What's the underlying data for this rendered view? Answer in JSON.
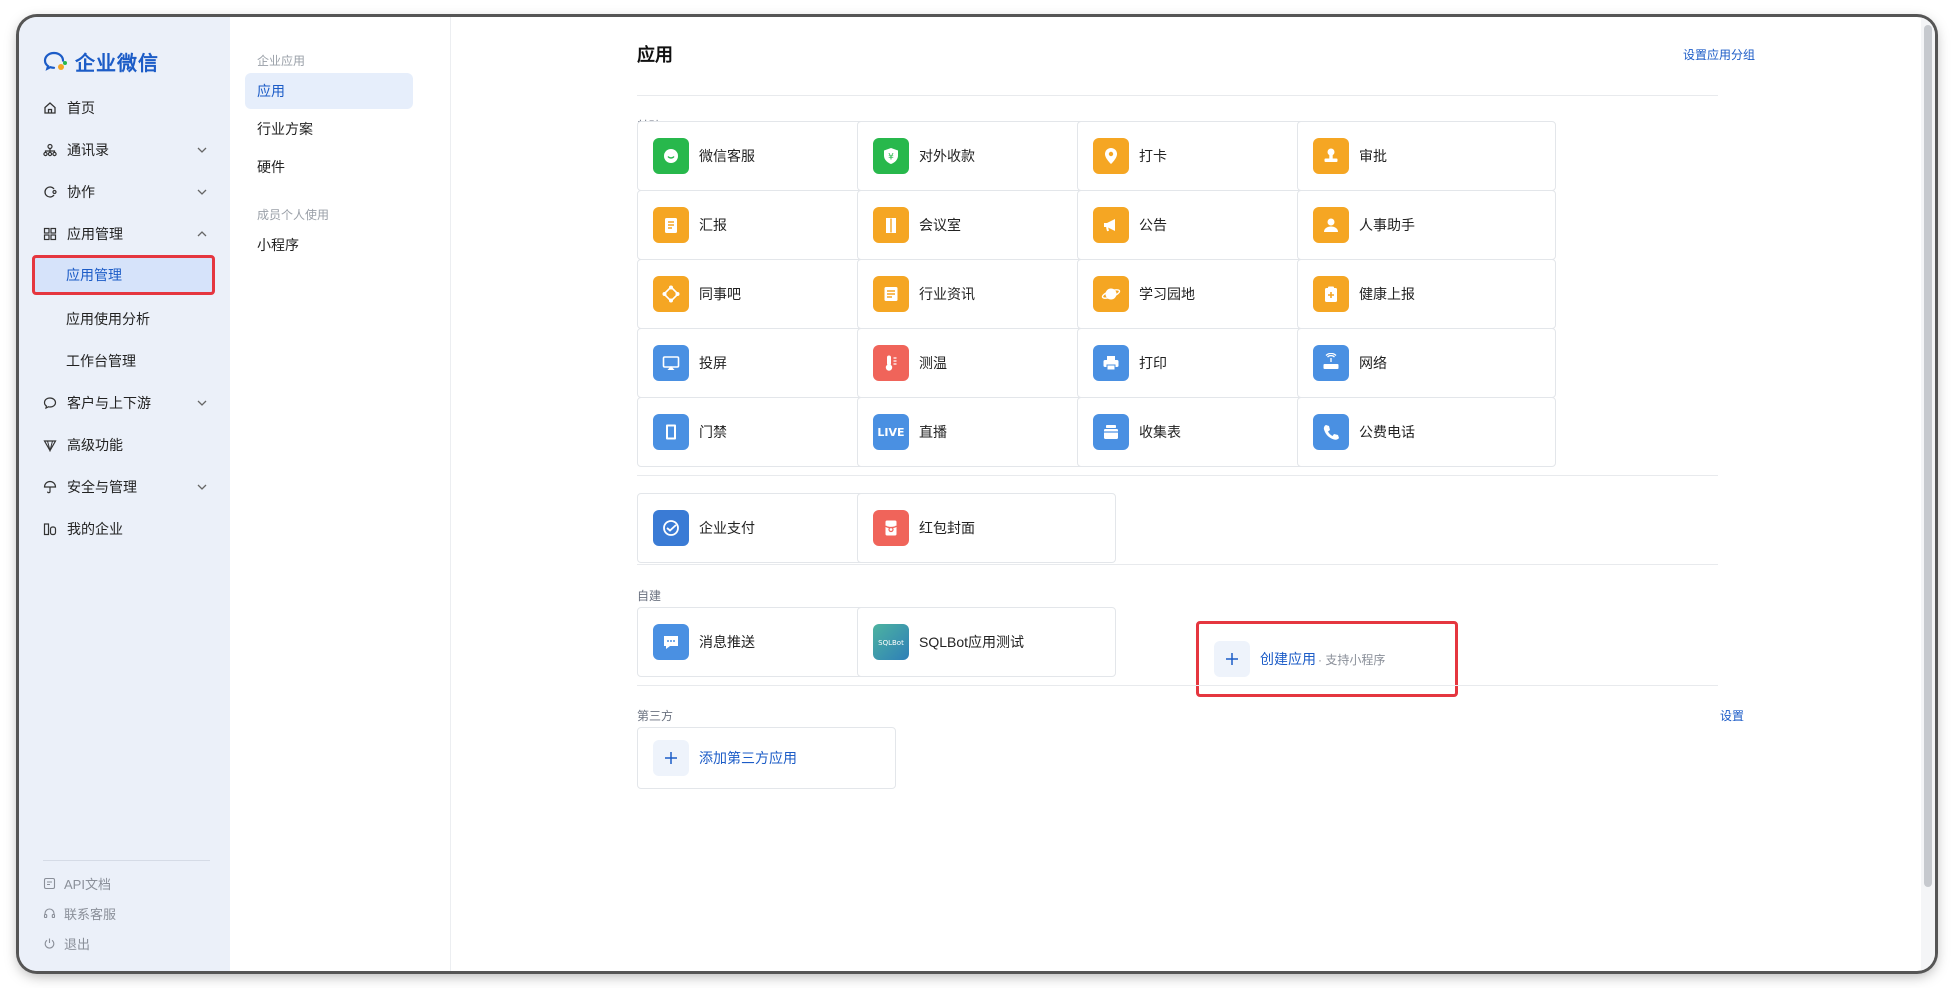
{
  "brand": {
    "name": "企业微信"
  },
  "sidebar": {
    "items": [
      {
        "label": "首页",
        "icon": "home-icon"
      },
      {
        "label": "通讯录",
        "icon": "org-chart-icon"
      },
      {
        "label": "协作",
        "icon": "collab-icon"
      },
      {
        "label": "应用管理",
        "icon": "grid-icon"
      }
    ],
    "sub_items": [
      {
        "label": "应用管理",
        "active": true
      },
      {
        "label": "应用使用分析"
      },
      {
        "label": "工作台管理"
      }
    ],
    "items2": [
      {
        "label": "客户与上下游",
        "icon": "chat-bubble-icon"
      },
      {
        "label": "高级功能",
        "icon": "diamond-icon"
      },
      {
        "label": "安全与管理",
        "icon": "umbrella-icon"
      },
      {
        "label": "我的企业",
        "icon": "building-icon"
      }
    ],
    "footer": [
      {
        "label": "API文档",
        "icon": "doc-icon"
      },
      {
        "label": "联系客服",
        "icon": "headset-icon"
      },
      {
        "label": "退出",
        "icon": "power-icon"
      }
    ]
  },
  "subnav": {
    "group1_label": "企业应用",
    "group1": [
      "应用",
      "行业方案",
      "硬件"
    ],
    "group2_label": "成员个人使用",
    "group2": [
      "小程序"
    ]
  },
  "main": {
    "title": "应用",
    "top_link": "设置应用分组",
    "basic_label": "基础",
    "basic_apps": [
      {
        "label": "微信客服",
        "icon": "wechat-service-icon",
        "color": "#28b84c"
      },
      {
        "label": "对外收款",
        "icon": "shield-yen-icon",
        "color": "#28b84c"
      },
      {
        "label": "打卡",
        "icon": "location-pin-icon",
        "color": "#f5a623"
      },
      {
        "label": "审批",
        "icon": "stamp-icon",
        "color": "#f5a623"
      },
      {
        "label": "汇报",
        "icon": "report-doc-icon",
        "color": "#f5a623"
      },
      {
        "label": "会议室",
        "icon": "door-icon",
        "color": "#f5a623"
      },
      {
        "label": "公告",
        "icon": "megaphone-icon",
        "color": "#f5a623"
      },
      {
        "label": "人事助手",
        "icon": "person-icon",
        "color": "#f5a623"
      },
      {
        "label": "同事吧",
        "icon": "network-icon",
        "color": "#f5a623"
      },
      {
        "label": "行业资讯",
        "icon": "news-icon",
        "color": "#f5a623"
      },
      {
        "label": "学习园地",
        "icon": "planet-icon",
        "color": "#f5a623"
      },
      {
        "label": "健康上报",
        "icon": "clipboard-plus-icon",
        "color": "#f5a623"
      },
      {
        "label": "投屏",
        "icon": "screen-cast-icon",
        "color": "#4a90e2"
      },
      {
        "label": "测温",
        "icon": "thermometer-icon",
        "color": "#f0645a"
      },
      {
        "label": "打印",
        "icon": "printer-icon",
        "color": "#4a90e2"
      },
      {
        "label": "网络",
        "icon": "router-icon",
        "color": "#4a90e2"
      },
      {
        "label": "门禁",
        "icon": "door-access-icon",
        "color": "#4a90e2"
      },
      {
        "label": "直播",
        "icon": "live-icon",
        "color": "#4a90e2",
        "badge": "LIVE"
      },
      {
        "label": "收集表",
        "icon": "tray-icon",
        "color": "#4a90e2"
      },
      {
        "label": "公费电话",
        "icon": "phone-icon",
        "color": "#4a90e2"
      }
    ],
    "extra_apps": [
      {
        "label": "企业支付",
        "icon": "pay-icon",
        "color": "#3a7bd5"
      },
      {
        "label": "红包封面",
        "icon": "red-envelope-icon",
        "color": "#f0645a"
      }
    ],
    "custom_label": "自建",
    "custom_apps": [
      {
        "label": "消息推送",
        "icon": "message-push-icon",
        "color": "#4a90e2"
      },
      {
        "label": "SQLBot应用测试",
        "icon": "sqlbot-icon",
        "color": "#3aa38f",
        "badge": "SQLBot"
      }
    ],
    "create": {
      "label": "创建应用",
      "sub": "· 支持小程序"
    },
    "third_label": "第三方",
    "third_link": "设置",
    "third_add": "添加第三方应用"
  }
}
